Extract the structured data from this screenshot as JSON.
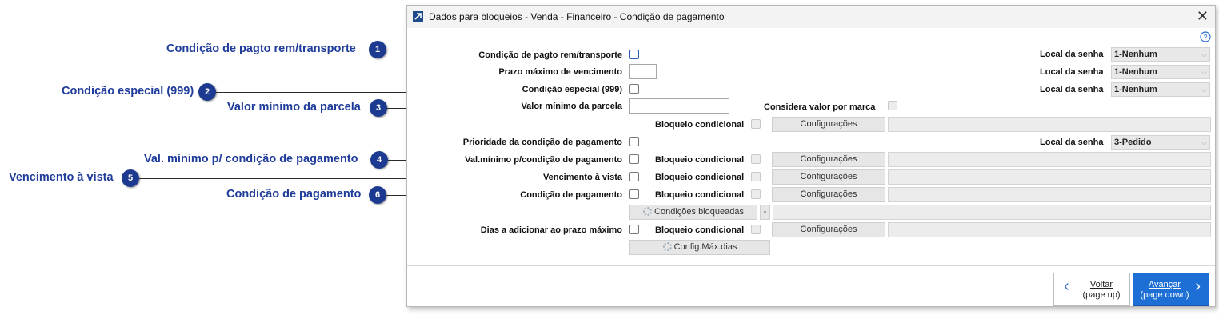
{
  "callouts": [
    {
      "num": "1",
      "text": "Condição de pagto rem/transporte"
    },
    {
      "num": "2",
      "text": "Condição especial (999)"
    },
    {
      "num": "3",
      "text": "Valor mínimo da parcela"
    },
    {
      "num": "4",
      "text": "Val. mínimo p/ condição de pagamento"
    },
    {
      "num": "5",
      "text": "Vencimento à vista"
    },
    {
      "num": "6",
      "text": "Condição de pagamento"
    }
  ],
  "window": {
    "title": "Dados para bloqueios - Venda - Financeiro - Condição de pagamento",
    "close": "✕",
    "help": "?"
  },
  "form": {
    "cond_rem_transporte": "Condição de pagto rem/transporte",
    "prazo_maximo": "Prazo máximo de vencimento",
    "cond_especial": "Condição especial (999)",
    "valor_minimo_parcela": "Valor mínimo da parcela",
    "considera_valor_marca": "Considera valor por marca",
    "bloqueio_condicional": "Bloqueio condicional",
    "prioridade": "Prioridade da condição de pagamento",
    "val_minimo_cond": "Val.mínimo p/condição de pagamento",
    "vencimento_vista": "Vencimento à vista",
    "cond_pagamento": "Condição de pagamento",
    "dias_adicionar": "Dias a adicionar ao prazo máximo",
    "local_senha": "Local da senha",
    "configuracoes": "Configurações",
    "condicoes_bloqueadas": "Condições bloqueadas",
    "config_max_dias": "Config.Máx.dias",
    "dash": "-"
  },
  "selects": {
    "local_senha_1": "1-Nenhum",
    "local_senha_2": "1-Nenhum",
    "local_senha_3": "1-Nenhum",
    "local_senha_4": "3-Pedido"
  },
  "nav": {
    "voltar": "Voltar",
    "voltar_sub": "(page up)",
    "avancar": "Avançar",
    "avancar_sub": "(page down)"
  },
  "colors": {
    "callout_text": "#1f3c9a",
    "badge": "#1c3a8f",
    "accent_button": "#1d6fd6"
  }
}
